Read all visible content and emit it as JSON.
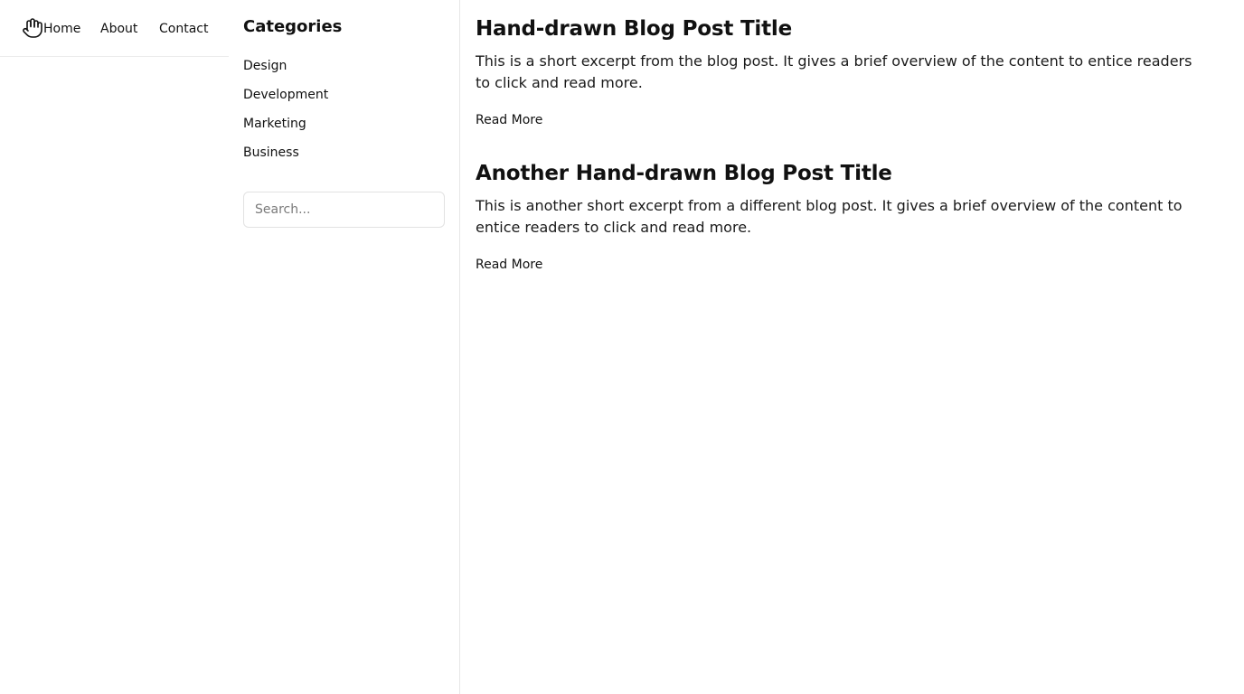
{
  "nav": {
    "logo_icon": "hand-icon",
    "links": [
      {
        "label": "Home"
      },
      {
        "label": "About"
      },
      {
        "label": "Contact"
      }
    ]
  },
  "sidebar": {
    "title": "Categories",
    "categories": [
      {
        "label": "Design"
      },
      {
        "label": "Development"
      },
      {
        "label": "Marketing"
      },
      {
        "label": "Business"
      }
    ],
    "search": {
      "placeholder": "Search...",
      "value": ""
    }
  },
  "posts": [
    {
      "title": "Hand-drawn Blog Post Title",
      "excerpt": "This is a short excerpt from the blog post. It gives a brief overview of the content to entice readers to click and read more.",
      "read_more": "Read More"
    },
    {
      "title": "Another Hand-drawn Blog Post Title",
      "excerpt": "This is another short excerpt from a different blog post. It gives a brief overview of the content to entice readers to click and read more.",
      "read_more": "Read More"
    }
  ]
}
